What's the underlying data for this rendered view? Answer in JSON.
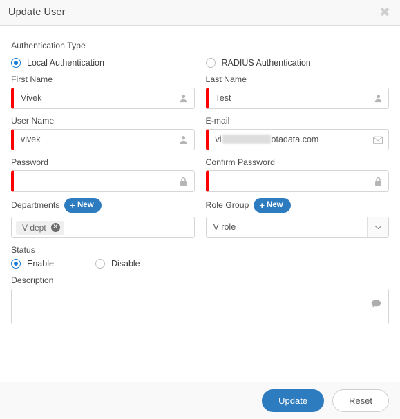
{
  "dialog": {
    "title": "Update User",
    "close_icon": "close-icon"
  },
  "auth": {
    "section_label": "Authentication Type",
    "options": [
      {
        "label": "Local Authentication",
        "selected": true
      },
      {
        "label": "RADIUS Authentication",
        "selected": false
      }
    ]
  },
  "fields": {
    "first_name": {
      "label": "First Name",
      "value": "Vivek",
      "icon": "user-icon",
      "required": true
    },
    "last_name": {
      "label": "Last Name",
      "value": "Test",
      "icon": "user-icon",
      "required": true
    },
    "user_name": {
      "label": "User Name",
      "value": "vivek",
      "icon": "user-icon",
      "required": true
    },
    "email": {
      "label": "E-mail",
      "value_prefix": "vi",
      "value_suffix": "otadata.com",
      "redacted": true,
      "icon": "envelope-icon",
      "required": true
    },
    "password": {
      "label": "Password",
      "value": "",
      "icon": "lock-icon",
      "required": true
    },
    "confirm_password": {
      "label": "Confirm Password",
      "value": "",
      "icon": "lock-icon",
      "required": true
    },
    "description": {
      "label": "Description",
      "value": "",
      "icon": "comment-icon",
      "required": false
    }
  },
  "departments": {
    "label": "Departments",
    "new_button": "New",
    "tags": [
      {
        "label": "V dept",
        "remove_icon": "remove-tag-icon"
      }
    ]
  },
  "role_group": {
    "label": "Role Group",
    "new_button": "New",
    "selected": "V role",
    "arrow_icon": "chevron-down-icon"
  },
  "status": {
    "label": "Status",
    "options": [
      {
        "label": "Enable",
        "selected": true
      },
      {
        "label": "Disable",
        "selected": false
      }
    ]
  },
  "footer": {
    "update_label": "Update",
    "reset_label": "Reset"
  },
  "colors": {
    "accent_blue": "#2e7cc0",
    "radio_blue": "#1d7dd4",
    "required_red": "#ff0000",
    "header_bg": "#f8f8f8"
  }
}
